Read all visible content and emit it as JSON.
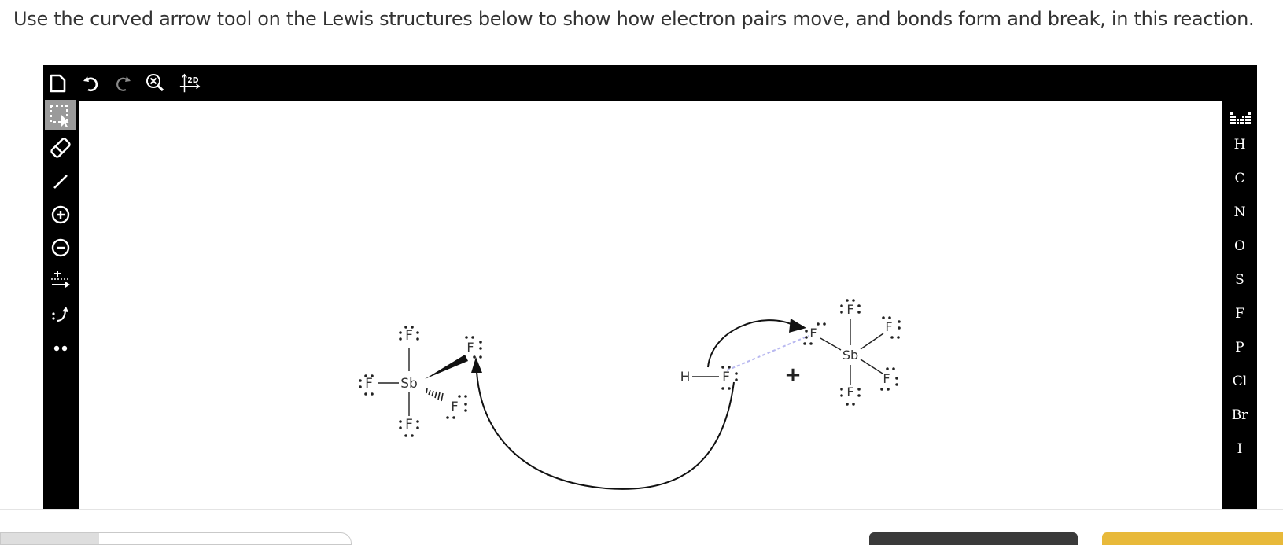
{
  "instructions": "Use the curved arrow tool on the Lewis structures below to show how electron pairs move, and bonds form and break, in this reaction.",
  "top_toolbar": {
    "items": [
      "new-document-icon",
      "undo-icon",
      "redo-icon",
      "zoom-clear-icon",
      "2d-clean-icon"
    ],
    "clean_label": "2D"
  },
  "left_toolbar": {
    "items": [
      "select-tool-icon",
      "eraser-icon",
      "bond-tool-icon",
      "positive-charge-icon",
      "negative-charge-icon",
      "reaction-arrow-icon",
      "curved-arrow-icon",
      "lone-pair-icon"
    ],
    "active": "select-tool-icon"
  },
  "right_toolbar": {
    "elements": [
      "H",
      "C",
      "N",
      "O",
      "S",
      "F",
      "P",
      "Cl",
      "Br",
      "I"
    ]
  },
  "molecules": {
    "sbf5": {
      "center": "Sb",
      "ligand": "F"
    },
    "hf": {
      "h": "H",
      "f": "F"
    },
    "plus": "+",
    "sbf6": {
      "center": "Sb",
      "ligand": "F"
    }
  },
  "colors": {
    "toolbar_bg": "#000000",
    "canvas_bg": "#ffffff",
    "active_tool": "#9a9a9a",
    "dashed_bond": "#b8b8f0",
    "submit_yellow": "#e8b93a",
    "dark_button": "#3a3a3a"
  }
}
